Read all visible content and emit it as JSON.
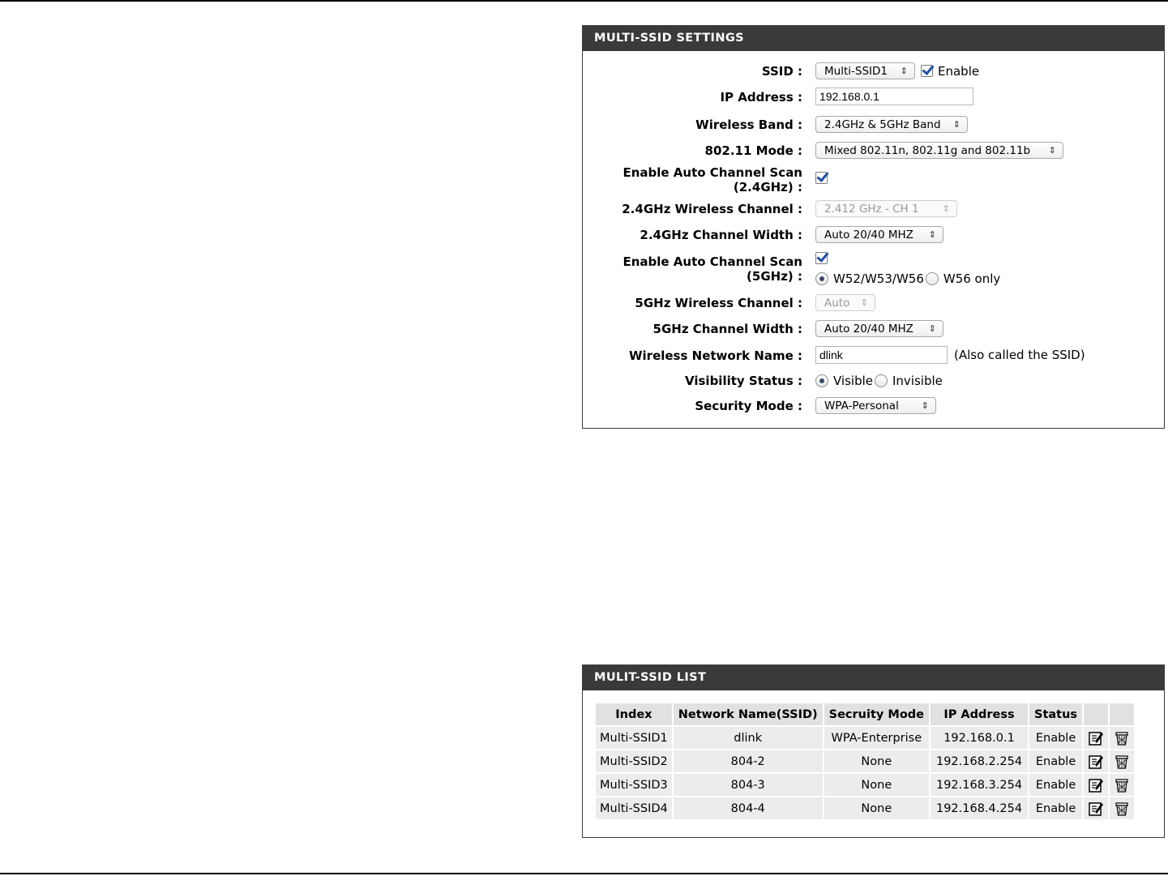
{
  "settings": {
    "title": "MULTI-SSID SETTINGS",
    "ssid": {
      "label": "SSID :",
      "value": "Multi-SSID1",
      "enable_label": "Enable",
      "enabled": true
    },
    "ip_address": {
      "label": "IP Address :",
      "value": "192.168.0.1"
    },
    "wireless_band": {
      "label": "Wireless Band :",
      "value": "2.4GHz & 5GHz Band"
    },
    "mode_80211": {
      "label": "802.11 Mode :",
      "value": "Mixed 802.11n, 802.11g and 802.11b"
    },
    "auto_scan_24": {
      "label_line1": "Enable Auto Channel Scan",
      "label_line2": "(2.4GHz) :",
      "checked": true
    },
    "channel_24": {
      "label": "2.4GHz Wireless Channel :",
      "value": "2.412 GHz - CH 1",
      "disabled": true
    },
    "width_24": {
      "label": "2.4GHz Channel Width :",
      "value": "Auto 20/40 MHZ"
    },
    "auto_scan_5": {
      "label_line1": "Enable Auto Channel Scan",
      "label_line2": "(5GHz) :",
      "checked": true,
      "option1": "W52/W53/W56",
      "option2": "W56 only",
      "selected": "W52/W53/W56"
    },
    "channel_5": {
      "label": "5GHz Wireless Channel :",
      "value": "Auto",
      "disabled": true
    },
    "width_5": {
      "label": "5GHz Channel Width :",
      "value": "Auto 20/40 MHZ"
    },
    "network_name": {
      "label": "Wireless Network Name :",
      "value": "dlink",
      "note": "(Also called the SSID)"
    },
    "visibility": {
      "label": "Visibility Status :",
      "option1": "Visible",
      "option2": "Invisible",
      "selected": "Visible"
    },
    "security_mode": {
      "label": "Security Mode :",
      "value": "WPA-Personal"
    }
  },
  "list": {
    "title": "MULIT-SSID LIST",
    "columns": [
      "Index",
      "Network Name(SSID)",
      "Secruity Mode",
      "IP Address",
      "Status"
    ],
    "rows": [
      {
        "index": "Multi-SSID1",
        "name": "dlink",
        "security": "WPA-Enterprise",
        "ip": "192.168.0.1",
        "status": "Enable"
      },
      {
        "index": "Multi-SSID2",
        "name": "804-2",
        "security": "None",
        "ip": "192.168.2.254",
        "status": "Enable"
      },
      {
        "index": "Multi-SSID3",
        "name": "804-3",
        "security": "None",
        "ip": "192.168.3.254",
        "status": "Enable"
      },
      {
        "index": "Multi-SSID4",
        "name": "804-4",
        "security": "None",
        "ip": "192.168.4.254",
        "status": "Enable"
      }
    ]
  },
  "icons": {
    "edit": "edit-icon",
    "delete": "trash-icon",
    "select_arrows": "updown-arrows-icon"
  }
}
